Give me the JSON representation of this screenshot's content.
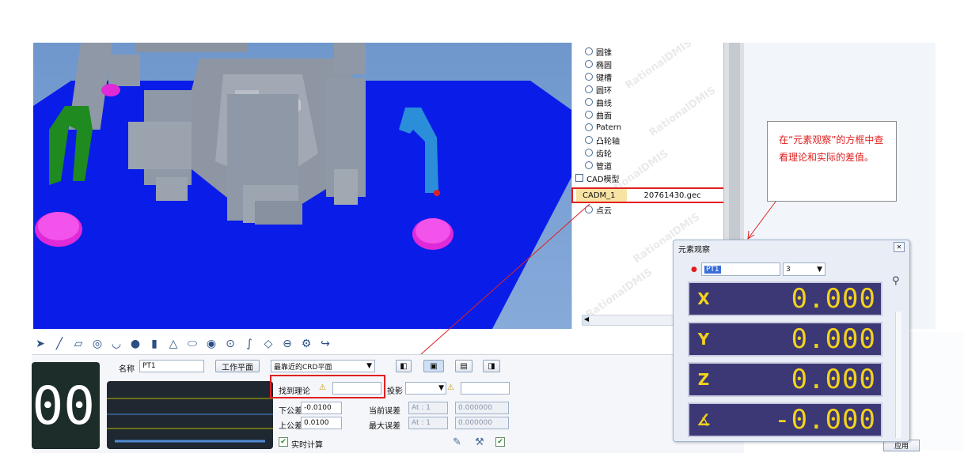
{
  "tree": {
    "items": [
      {
        "icon": "cone-icon",
        "label": "圆锥"
      },
      {
        "icon": "ellipse-icon",
        "label": "椭圆"
      },
      {
        "icon": "keyslot-icon",
        "label": "键槽"
      },
      {
        "icon": "torus-icon",
        "label": "圆环"
      },
      {
        "icon": "curve-icon",
        "label": "曲线"
      },
      {
        "icon": "surface-icon",
        "label": "曲面"
      },
      {
        "icon": "pattern-icon",
        "label": "Patern"
      },
      {
        "icon": "cam-icon",
        "label": "凸轮轴"
      },
      {
        "icon": "gear-icon",
        "label": "齿轮"
      },
      {
        "icon": "pipe-icon",
        "label": "管道"
      },
      {
        "icon": "cad-icon",
        "label": "CAD模型"
      }
    ],
    "cad_item": {
      "name": "CADM_1",
      "file": "20761430.gec"
    },
    "point_cloud_label": "点云",
    "watermark": "RationalDMIS"
  },
  "note": {
    "text": "在“元素观察”的方框中查看理论和实际的差值。"
  },
  "bottom_panel": {
    "big_display": "00",
    "name_label": "名称",
    "name_value": "PT1",
    "workplane_button": "工作平面",
    "plane_select": "最靠近的CRD平面",
    "snap_label": "找到理论",
    "projection_label": "投影",
    "lower_tol_label": "下公差",
    "lower_tol_value": "-0.0100",
    "upper_tol_label": "上公差",
    "upper_tol_value": "0.0100",
    "current_err_label": "当前误差",
    "max_err_label": "最大误差",
    "at_value": "At : 1",
    "err_value": "0.000000",
    "realtime_label": "实时计算"
  },
  "observer": {
    "title": "元素观察",
    "point_value": "PT1",
    "decimals_value": "3",
    "rows": [
      {
        "axis": "X",
        "value": "0.000"
      },
      {
        "axis": "Y",
        "value": "0.000"
      },
      {
        "axis": "Z",
        "value": "0.000"
      },
      {
        "axis": "angle",
        "value": "-0.000"
      }
    ]
  },
  "apply_label": "应用",
  "colors": {
    "annotation_red": "#e02020",
    "readout_bg": "#3b3875",
    "readout_text": "#f3d21d",
    "plate_blue": "#0a1de8"
  }
}
